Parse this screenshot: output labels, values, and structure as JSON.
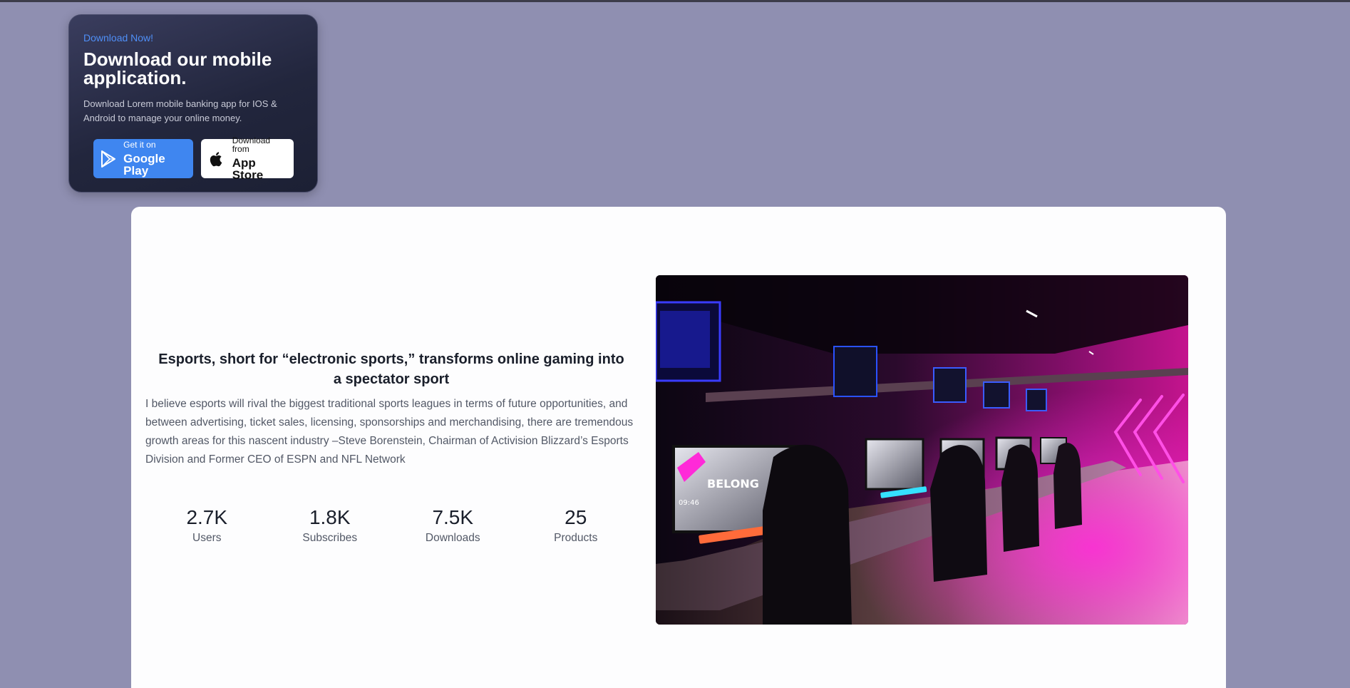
{
  "download_card": {
    "eyebrow": "Download Now!",
    "title": "Download our mobile application.",
    "description": "Download Lorem mobile banking app for IOS & Android to manage your online money.",
    "google_play": {
      "small": "Get it on",
      "big": "Google Play",
      "icon": "play-icon"
    },
    "app_store": {
      "small": "Download from",
      "big": "App Store",
      "icon": "apple-icon"
    }
  },
  "article": {
    "headline": "Esports, short for “electronic sports,” transforms online gaming into a spectator sport",
    "body": "I believe esports will rival the biggest traditional sports leagues in terms of future opportunities, and between advertising, ticket sales, licensing, sponsorships and merchandising, there are tremendous growth areas for this nascent industry –Steve Borenstein, Chairman of Activision Blizzard’s Esports Division and Former CEO of ESPN and NFL Network",
    "stats": [
      {
        "value": "2.7K",
        "label": "Users"
      },
      {
        "value": "1.8K",
        "label": "Subscribes"
      },
      {
        "value": "7.5K",
        "label": "Downloads"
      },
      {
        "value": "25",
        "label": "Products"
      }
    ]
  },
  "photo": {
    "screen_text": "BELONG",
    "clock_text": "09:46"
  },
  "colors": {
    "page_bg": "#8f8fb1",
    "card_bg": "#22263d",
    "accent_blue": "#3f86f0",
    "neon_pink": "#ff1fd6"
  }
}
